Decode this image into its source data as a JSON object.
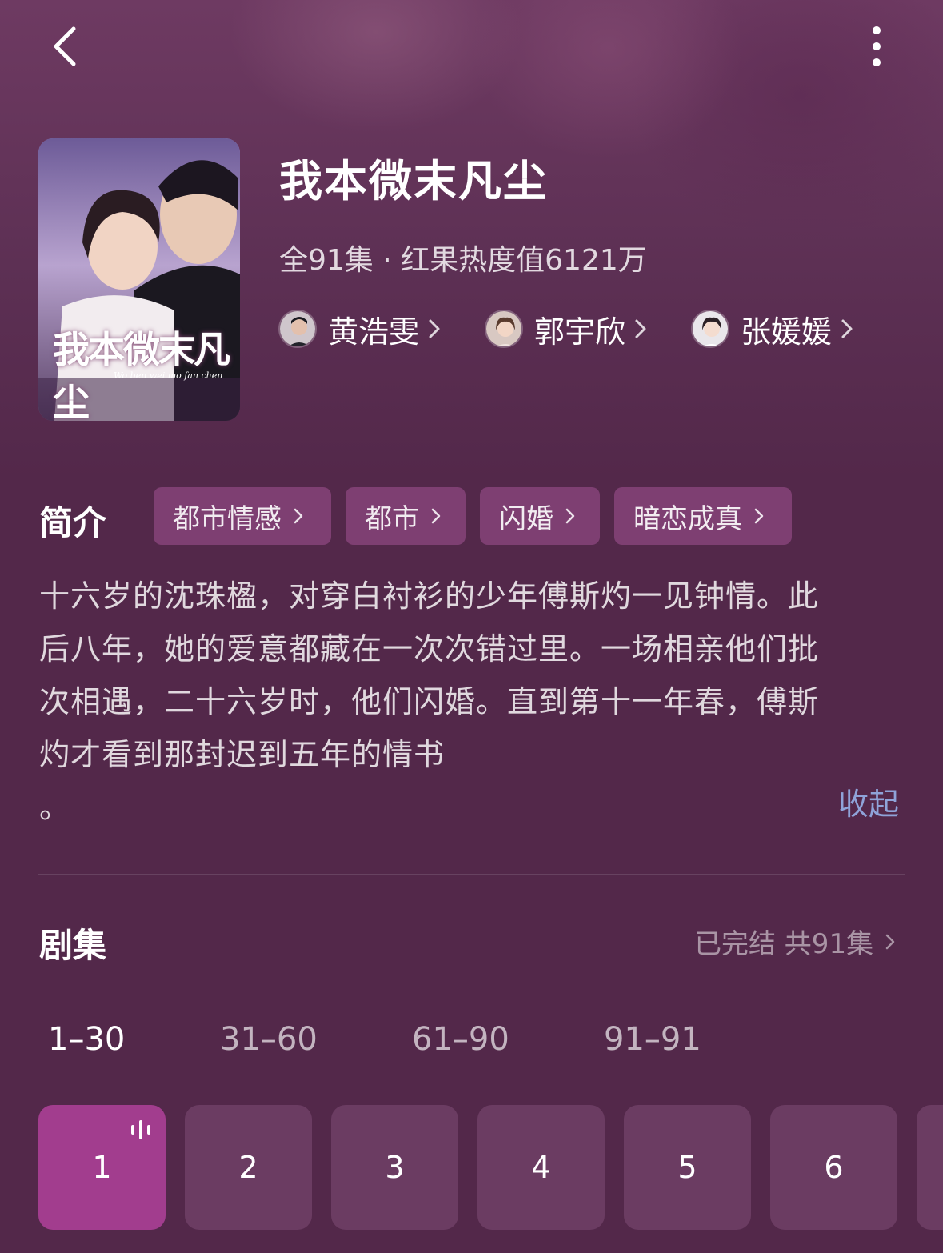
{
  "drama": {
    "title": "我本微末凡尘",
    "meta": "全91集 · 红果热度值6121万",
    "poster_title": "我本微末凡尘",
    "poster_subtitle": "Wo ben wei mo fan chen"
  },
  "cast": [
    {
      "name": "黄浩雯"
    },
    {
      "name": "郭宇欣"
    },
    {
      "name": "张媛媛"
    }
  ],
  "intro": {
    "title": "简介",
    "tags": [
      "都市情感",
      "都市",
      "闪婚",
      "暗恋成真"
    ],
    "lines": [
      "十六岁的沈珠楹，对穿白衬衫的少年傅斯灼一见钟情。此",
      "后八年，她的爱意都藏在一次次错过里。一场相亲他们批",
      "次相遇，二十六岁时，他们闪婚。直到第十一年春，傅斯",
      "灼才看到那封迟到五年的情书",
      "。"
    ],
    "collapse_label": "收起"
  },
  "episodes": {
    "title": "剧集",
    "status": "已完结 共91集",
    "ranges": [
      "1–30",
      "31–60",
      "61–90",
      "91–91"
    ],
    "active_range": 0,
    "items": [
      "1",
      "2",
      "3",
      "4",
      "5",
      "6"
    ],
    "active_episode": 0
  },
  "colors": {
    "background": "#53284a",
    "tag_bg": "#7e3f72",
    "episode_bg": "#6b3c62",
    "episode_active_bg": "#a23d8e",
    "link": "#8fa3d9"
  },
  "icons": {
    "back": "chevron-left-icon",
    "more": "more-vertical-icon",
    "chevron": "chevron-right-icon",
    "playing": "audio-bars-icon"
  }
}
